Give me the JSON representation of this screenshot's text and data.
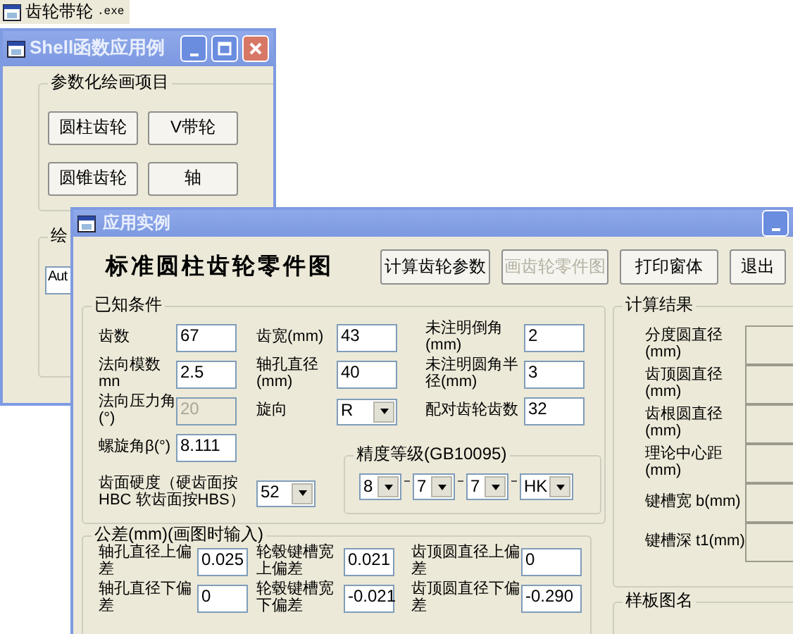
{
  "taskbar_label": {
    "title": "齿轮带轮",
    "extension": ".exe"
  },
  "back_window": {
    "title": "Shell函数应用例",
    "group": {
      "title": "参数化绘画项目",
      "buttons": [
        "圆柱齿轮",
        "V带轮",
        "圆锥齿轮",
        "轴"
      ]
    },
    "group_2": {
      "title": "绘",
      "field_value": "Aut"
    }
  },
  "main_window": {
    "title": "应用实例",
    "heading": "标准圆柱齿轮零件图",
    "buttons": [
      {
        "label": "计算齿轮参数",
        "disabled": false
      },
      {
        "label": "画齿轮零件图",
        "disabled": true
      },
      {
        "label": "打印窗体",
        "disabled": false
      },
      {
        "label": "退出",
        "disabled": false
      }
    ],
    "known_conditions": {
      "title": "已知条件",
      "rows": [
        [
          {
            "label": "齿数",
            "value": "67",
            "kind": "input",
            "disabled": false
          },
          {
            "label": "齿宽(mm)",
            "value": "43",
            "kind": "input",
            "disabled": false
          },
          {
            "label": "未注明倒角(mm)",
            "value": "2",
            "kind": "input",
            "disabled": false
          }
        ],
        [
          {
            "label": "法向模数 mn",
            "value": "2.5",
            "kind": "input",
            "disabled": false
          },
          {
            "label": "轴孔直径(mm)",
            "value": "40",
            "kind": "input",
            "disabled": false
          },
          {
            "label": "未注明圆角半径(mm)",
            "value": "3",
            "kind": "input",
            "disabled": false
          }
        ],
        [
          {
            "label": "法向压力角(°)",
            "value": "20",
            "kind": "input",
            "disabled": true
          },
          {
            "label": "旋向",
            "value": "R",
            "kind": "select",
            "disabled": false
          },
          {
            "label": "配对齿轮齿数",
            "value": "32",
            "kind": "input",
            "disabled": false
          }
        ],
        [
          {
            "label": "螺旋角β(°)",
            "value": "8.111",
            "kind": "input",
            "disabled": false
          }
        ],
        [
          {
            "label": "齿面硬度（硬齿面按HBC 软齿面按HBS）",
            "value": "52",
            "kind": "select",
            "disabled": false
          }
        ]
      ],
      "precision": {
        "title": "精度等级(GB10095)",
        "values": [
          "8",
          "7",
          "7",
          "HK"
        ]
      }
    },
    "tolerance": {
      "title": "公差(mm)(画图时输入)",
      "rows": [
        [
          {
            "label": "轴孔直径上偏差",
            "value": "0.025"
          },
          {
            "label": "轮毂键槽宽上偏差",
            "value": "0.021"
          },
          {
            "label": "齿顶圆直径上偏差",
            "value": "0"
          }
        ],
        [
          {
            "label": "轴孔直径下偏差",
            "value": "0"
          },
          {
            "label": "轮毂键槽宽下偏差",
            "value": "-0.021"
          },
          {
            "label": "齿顶圆直径下偏差",
            "value": "-0.290"
          }
        ]
      ]
    },
    "results": {
      "title": "计算结果",
      "labels": [
        "分度圆直径(mm)",
        "齿顶圆直径(mm)",
        "齿根圆直径(mm)",
        "理论中心距(mm)",
        "键槽宽 b(mm)",
        "键槽深 t1(mm)"
      ]
    },
    "template": {
      "title": "样板图名"
    }
  }
}
